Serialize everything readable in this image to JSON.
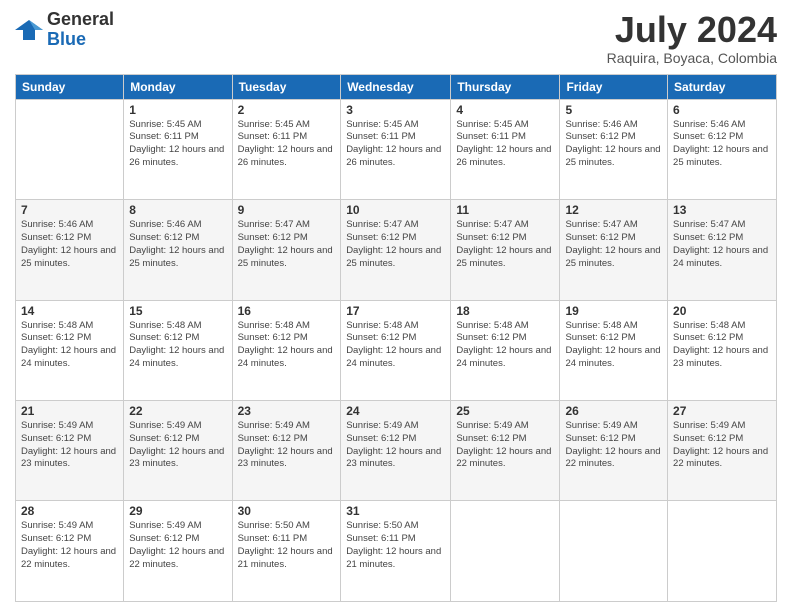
{
  "header": {
    "logo_general": "General",
    "logo_blue": "Blue",
    "month_year": "July 2024",
    "location": "Raquira, Boyaca, Colombia"
  },
  "days_of_week": [
    "Sunday",
    "Monday",
    "Tuesday",
    "Wednesday",
    "Thursday",
    "Friday",
    "Saturday"
  ],
  "weeks": [
    [
      {
        "day": "",
        "sunrise": "",
        "sunset": "",
        "daylight": ""
      },
      {
        "day": "1",
        "sunrise": "5:45 AM",
        "sunset": "6:11 PM",
        "daylight": "12 hours and 26 minutes."
      },
      {
        "day": "2",
        "sunrise": "5:45 AM",
        "sunset": "6:11 PM",
        "daylight": "12 hours and 26 minutes."
      },
      {
        "day": "3",
        "sunrise": "5:45 AM",
        "sunset": "6:11 PM",
        "daylight": "12 hours and 26 minutes."
      },
      {
        "day": "4",
        "sunrise": "5:45 AM",
        "sunset": "6:11 PM",
        "daylight": "12 hours and 26 minutes."
      },
      {
        "day": "5",
        "sunrise": "5:46 AM",
        "sunset": "6:12 PM",
        "daylight": "12 hours and 25 minutes."
      },
      {
        "day": "6",
        "sunrise": "5:46 AM",
        "sunset": "6:12 PM",
        "daylight": "12 hours and 25 minutes."
      }
    ],
    [
      {
        "day": "7",
        "sunrise": "5:46 AM",
        "sunset": "6:12 PM",
        "daylight": "12 hours and 25 minutes."
      },
      {
        "day": "8",
        "sunrise": "5:46 AM",
        "sunset": "6:12 PM",
        "daylight": "12 hours and 25 minutes."
      },
      {
        "day": "9",
        "sunrise": "5:47 AM",
        "sunset": "6:12 PM",
        "daylight": "12 hours and 25 minutes."
      },
      {
        "day": "10",
        "sunrise": "5:47 AM",
        "sunset": "6:12 PM",
        "daylight": "12 hours and 25 minutes."
      },
      {
        "day": "11",
        "sunrise": "5:47 AM",
        "sunset": "6:12 PM",
        "daylight": "12 hours and 25 minutes."
      },
      {
        "day": "12",
        "sunrise": "5:47 AM",
        "sunset": "6:12 PM",
        "daylight": "12 hours and 25 minutes."
      },
      {
        "day": "13",
        "sunrise": "5:47 AM",
        "sunset": "6:12 PM",
        "daylight": "12 hours and 24 minutes."
      }
    ],
    [
      {
        "day": "14",
        "sunrise": "5:48 AM",
        "sunset": "6:12 PM",
        "daylight": "12 hours and 24 minutes."
      },
      {
        "day": "15",
        "sunrise": "5:48 AM",
        "sunset": "6:12 PM",
        "daylight": "12 hours and 24 minutes."
      },
      {
        "day": "16",
        "sunrise": "5:48 AM",
        "sunset": "6:12 PM",
        "daylight": "12 hours and 24 minutes."
      },
      {
        "day": "17",
        "sunrise": "5:48 AM",
        "sunset": "6:12 PM",
        "daylight": "12 hours and 24 minutes."
      },
      {
        "day": "18",
        "sunrise": "5:48 AM",
        "sunset": "6:12 PM",
        "daylight": "12 hours and 24 minutes."
      },
      {
        "day": "19",
        "sunrise": "5:48 AM",
        "sunset": "6:12 PM",
        "daylight": "12 hours and 24 minutes."
      },
      {
        "day": "20",
        "sunrise": "5:48 AM",
        "sunset": "6:12 PM",
        "daylight": "12 hours and 23 minutes."
      }
    ],
    [
      {
        "day": "21",
        "sunrise": "5:49 AM",
        "sunset": "6:12 PM",
        "daylight": "12 hours and 23 minutes."
      },
      {
        "day": "22",
        "sunrise": "5:49 AM",
        "sunset": "6:12 PM",
        "daylight": "12 hours and 23 minutes."
      },
      {
        "day": "23",
        "sunrise": "5:49 AM",
        "sunset": "6:12 PM",
        "daylight": "12 hours and 23 minutes."
      },
      {
        "day": "24",
        "sunrise": "5:49 AM",
        "sunset": "6:12 PM",
        "daylight": "12 hours and 23 minutes."
      },
      {
        "day": "25",
        "sunrise": "5:49 AM",
        "sunset": "6:12 PM",
        "daylight": "12 hours and 22 minutes."
      },
      {
        "day": "26",
        "sunrise": "5:49 AM",
        "sunset": "6:12 PM",
        "daylight": "12 hours and 22 minutes."
      },
      {
        "day": "27",
        "sunrise": "5:49 AM",
        "sunset": "6:12 PM",
        "daylight": "12 hours and 22 minutes."
      }
    ],
    [
      {
        "day": "28",
        "sunrise": "5:49 AM",
        "sunset": "6:12 PM",
        "daylight": "12 hours and 22 minutes."
      },
      {
        "day": "29",
        "sunrise": "5:49 AM",
        "sunset": "6:12 PM",
        "daylight": "12 hours and 22 minutes."
      },
      {
        "day": "30",
        "sunrise": "5:50 AM",
        "sunset": "6:11 PM",
        "daylight": "12 hours and 21 minutes."
      },
      {
        "day": "31",
        "sunrise": "5:50 AM",
        "sunset": "6:11 PM",
        "daylight": "12 hours and 21 minutes."
      },
      {
        "day": "",
        "sunrise": "",
        "sunset": "",
        "daylight": ""
      },
      {
        "day": "",
        "sunrise": "",
        "sunset": "",
        "daylight": ""
      },
      {
        "day": "",
        "sunrise": "",
        "sunset": "",
        "daylight": ""
      }
    ]
  ]
}
